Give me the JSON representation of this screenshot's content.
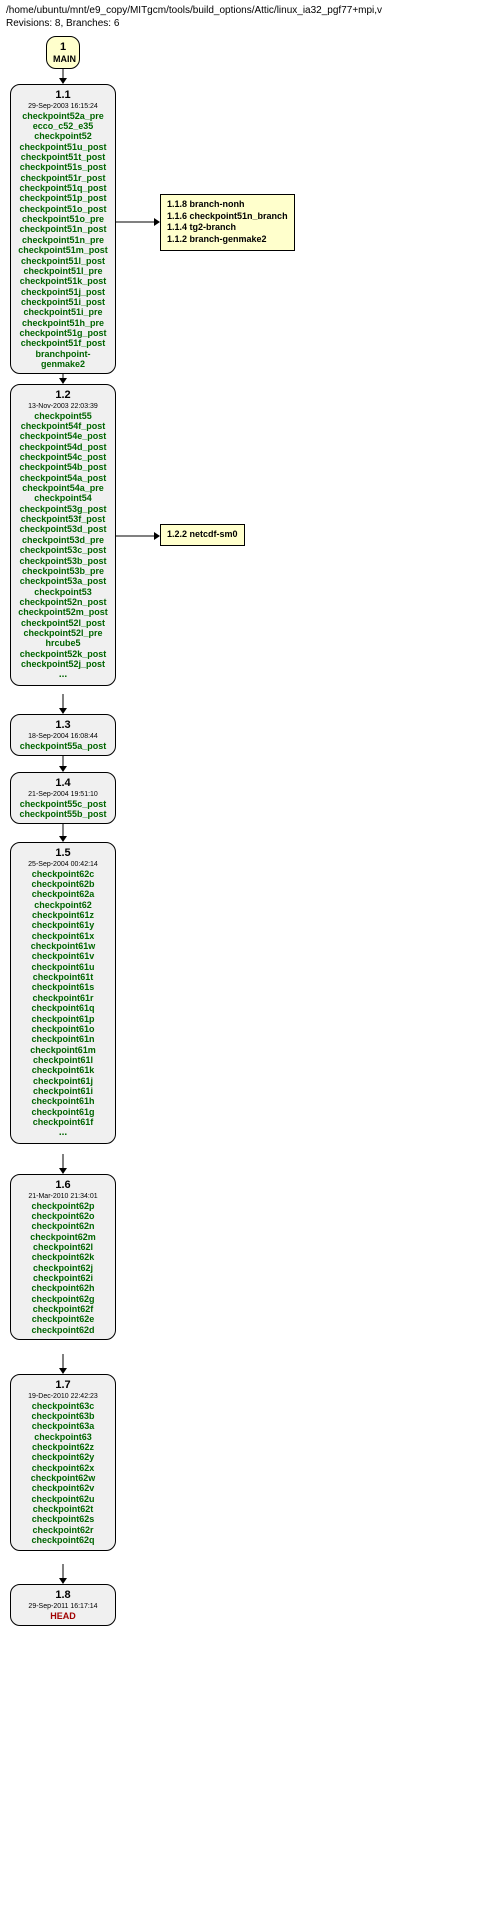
{
  "header": {
    "path": "/home/ubuntu/mnt/e9_copy/MITgcm/tools/build_options/Attic/linux_ia32_pgf77+mpi,v",
    "stats": "Revisions: 8, Branches: 6"
  },
  "main": {
    "rev": "1",
    "label": "MAIN"
  },
  "nodes": {
    "r11": {
      "rev": "1.1",
      "date": "29-Sep-2003 16:15:24",
      "tags": [
        "checkpoint52a_pre",
        "ecco_c52_e35",
        "checkpoint52",
        "checkpoint51u_post",
        "checkpoint51t_post",
        "checkpoint51s_post",
        "checkpoint51r_post",
        "checkpoint51q_post",
        "checkpoint51p_post",
        "checkpoint51o_post",
        "checkpoint51o_pre",
        "checkpoint51n_post",
        "checkpoint51n_pre",
        "checkpoint51m_post",
        "checkpoint51l_post",
        "checkpoint51l_pre",
        "checkpoint51k_post",
        "checkpoint51j_post",
        "checkpoint51i_post",
        "checkpoint51i_pre",
        "checkpoint51h_pre",
        "checkpoint51g_post",
        "checkpoint51f_post",
        "branchpoint-genmake2"
      ]
    },
    "r12": {
      "rev": "1.2",
      "date": "13-Nov-2003 22:03:39",
      "tags": [
        "checkpoint55",
        "checkpoint54f_post",
        "checkpoint54e_post",
        "checkpoint54d_post",
        "checkpoint54c_post",
        "checkpoint54b_post",
        "checkpoint54a_post",
        "checkpoint54a_pre",
        "checkpoint54",
        "checkpoint53g_post",
        "checkpoint53f_post",
        "checkpoint53d_post",
        "checkpoint53d_pre",
        "checkpoint53c_post",
        "checkpoint53b_post",
        "checkpoint53b_pre",
        "checkpoint53a_post",
        "checkpoint53",
        "checkpoint52n_post",
        "checkpoint52m_post",
        "checkpoint52l_post",
        "checkpoint52l_pre",
        "hrcube5",
        "checkpoint52k_post",
        "checkpoint52j_post"
      ],
      "more": "..."
    },
    "r13": {
      "rev": "1.3",
      "date": "18-Sep-2004 16:08:44",
      "tags": [
        "checkpoint55a_post"
      ]
    },
    "r14": {
      "rev": "1.4",
      "date": "21-Sep-2004 19:51:10",
      "tags": [
        "checkpoint55c_post",
        "checkpoint55b_post"
      ]
    },
    "r15": {
      "rev": "1.5",
      "date": "25-Sep-2004 00:42:14",
      "tags": [
        "checkpoint62c",
        "checkpoint62b",
        "checkpoint62a",
        "checkpoint62",
        "checkpoint61z",
        "checkpoint61y",
        "checkpoint61x",
        "checkpoint61w",
        "checkpoint61v",
        "checkpoint61u",
        "checkpoint61t",
        "checkpoint61s",
        "checkpoint61r",
        "checkpoint61q",
        "checkpoint61p",
        "checkpoint61o",
        "checkpoint61n",
        "checkpoint61m",
        "checkpoint61l",
        "checkpoint61k",
        "checkpoint61j",
        "checkpoint61i",
        "checkpoint61h",
        "checkpoint61g",
        "checkpoint61f"
      ],
      "more": "..."
    },
    "r16": {
      "rev": "1.6",
      "date": "21-Mar-2010 21:34:01",
      "tags": [
        "checkpoint62p",
        "checkpoint62o",
        "checkpoint62n",
        "checkpoint62m",
        "checkpoint62l",
        "checkpoint62k",
        "checkpoint62j",
        "checkpoint62i",
        "checkpoint62h",
        "checkpoint62g",
        "checkpoint62f",
        "checkpoint62e",
        "checkpoint62d"
      ]
    },
    "r17": {
      "rev": "1.7",
      "date": "19-Dec-2010 22:42:23",
      "tags": [
        "checkpoint63c",
        "checkpoint63b",
        "checkpoint63a",
        "checkpoint63",
        "checkpoint62z",
        "checkpoint62y",
        "checkpoint62x",
        "checkpoint62w",
        "checkpoint62v",
        "checkpoint62u",
        "checkpoint62t",
        "checkpoint62s",
        "checkpoint62r",
        "checkpoint62q"
      ]
    },
    "r18": {
      "rev": "1.8",
      "date": "29-Sep-2011 16:17:14",
      "tags_red": [
        "HEAD"
      ]
    }
  },
  "branchnote1": {
    "lines": [
      {
        "num": "1.1.8",
        "name": "branch-nonh"
      },
      {
        "num": "1.1.6",
        "name": "checkpoint51n_branch"
      },
      {
        "num": "1.1.4",
        "name": "tg2-branch"
      },
      {
        "num": "1.1.2",
        "name": "branch-genmake2"
      }
    ]
  },
  "branchnote2": {
    "lines": [
      {
        "num": "1.2.2",
        "name": "netcdf-sm0"
      }
    ]
  }
}
